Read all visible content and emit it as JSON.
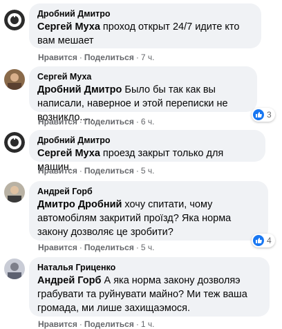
{
  "actions": {
    "like": "Нравится",
    "reply": "Поделиться",
    "separator": "·"
  },
  "comments": [
    {
      "author": "Дробний Дмитро",
      "mention": "Сергей Муха",
      "text": " проход открыт 24/7 идите кто вам мешает",
      "time": "7 ч.",
      "reactions": null,
      "avatar_icon": "app-logo-avatar"
    },
    {
      "author": "Сергей Муха",
      "mention": "Дробний Дмитро",
      "text": " Было бы так как вы написали, наверное и этой переписки не возникло.....",
      "time": "6 ч.",
      "reactions": "3",
      "avatar_icon": "person-avatar"
    },
    {
      "author": "Дробний Дмитро",
      "mention": "Сергей Муха",
      "text": " проезд закрыт только для машин.",
      "time": "5 ч.",
      "reactions": null,
      "avatar_icon": "app-logo-avatar"
    },
    {
      "author": "Андрей Горб",
      "mention": "Дмитро Дробний",
      "text": " хочу спитати, чому автомобілям закритий проїзд? Яка норма закону дозволяє це зробити?",
      "time": "5 ч.",
      "reactions": "4",
      "avatar_icon": "person-avatar"
    },
    {
      "author": "Наталья Гриценко",
      "mention": "Андрей Горб",
      "text": " А яка норма закону дозволяэ грабувати та руйнувати майно? Ми теж ваша громада, ми лише захищаэмося.",
      "time": "1 ч.",
      "reactions": null,
      "avatar_icon": "person-avatar"
    }
  ],
  "colors": {
    "bubble": "#f0f2f5",
    "secondary_text": "#65676b",
    "like_blue": "#1877f2"
  }
}
